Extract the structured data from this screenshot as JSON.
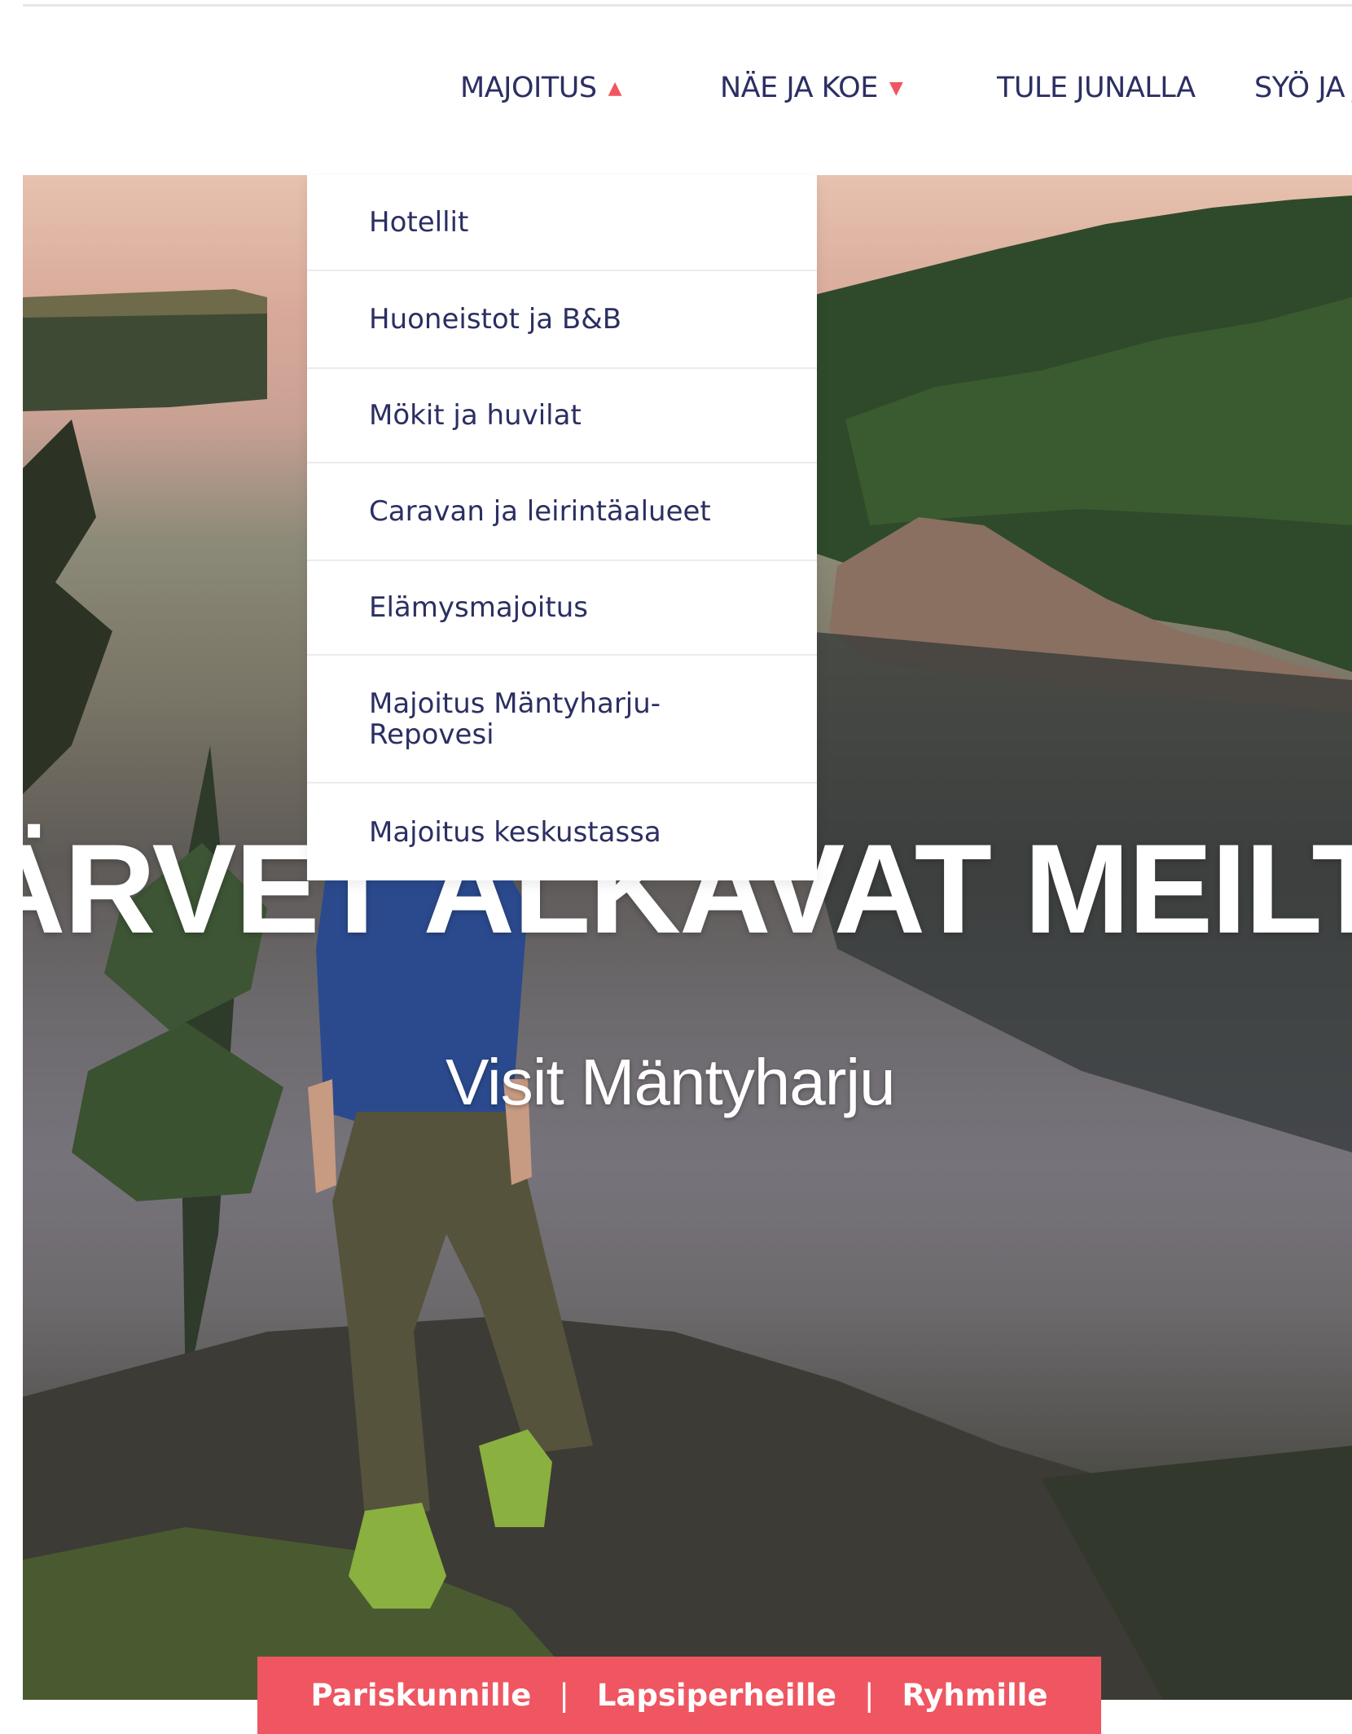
{
  "nav": {
    "items": [
      {
        "label": "MAJOITUS",
        "arrow": "▲"
      },
      {
        "label": "NÄE JA KOE",
        "arrow": "▼"
      },
      {
        "label": "TULE JUNALLA"
      },
      {
        "label": "SYÖ JA J"
      }
    ]
  },
  "dropdown": {
    "items": [
      {
        "label": "Hotellit"
      },
      {
        "label": "Huoneistot ja B&B"
      },
      {
        "label": "Mökit ja huvilat"
      },
      {
        "label": "Caravan ja leirintäalueet"
      },
      {
        "label": "Elämysmajoitus"
      },
      {
        "label": "Majoitus Mäntyharju-Repovesi"
      },
      {
        "label": "Majoitus keskustassa"
      }
    ]
  },
  "hero": {
    "title": "ÄRVET ALKAVAT MEILTÄ",
    "subtitle": "Visit Mäntyharju"
  },
  "audience_bar": {
    "items": [
      {
        "label": "Pariskunnille"
      },
      {
        "label": "Lapsiperheille"
      },
      {
        "label": "Ryhmille"
      }
    ],
    "separator": "|"
  },
  "colors": {
    "accent": "#ef5661",
    "nav_text": "#2b2f62"
  }
}
